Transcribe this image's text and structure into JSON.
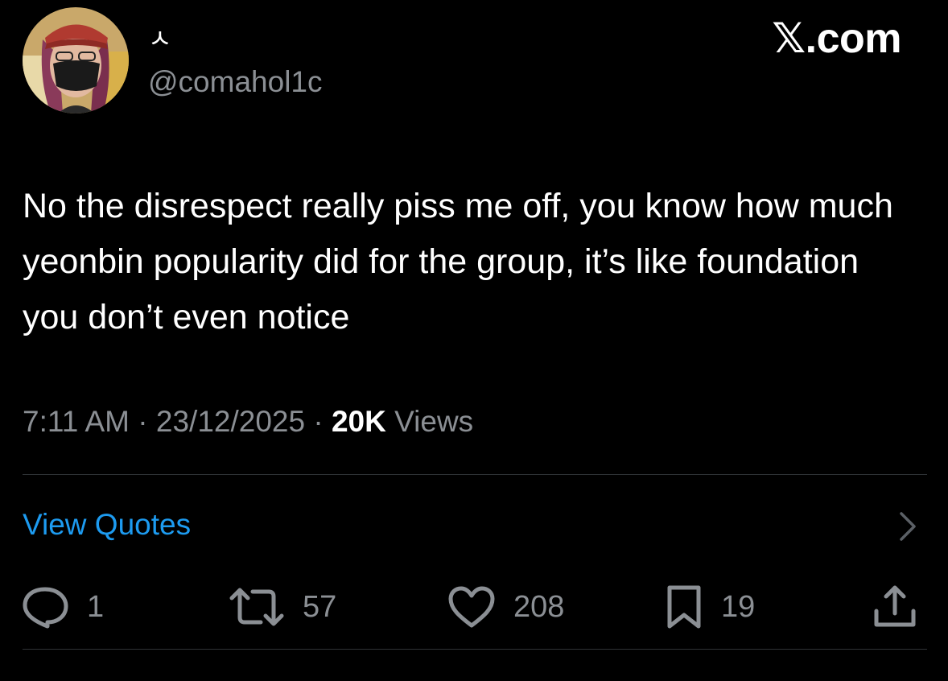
{
  "author": {
    "display_name": "ㅅ",
    "handle": "@comahol1c",
    "avatar_icon": "avatar-image"
  },
  "brand": {
    "logo_glyph": "𝕏",
    "logo_suffix": ".com"
  },
  "tweet": {
    "text": "No the disrespect really piss me off, you know how much yeonbin popularity did for the group, it’s like foundation you don’t even notice",
    "time": "7:11 AM",
    "separator": "·",
    "date": "23/12/2025",
    "views_count": "20K",
    "views_label": "Views"
  },
  "quotes": {
    "label": "View Quotes",
    "chevron_icon": "chevron-right-icon"
  },
  "actions": {
    "reply": {
      "icon": "reply-icon",
      "count": "1"
    },
    "retweet": {
      "icon": "retweet-icon",
      "count": "57"
    },
    "like": {
      "icon": "heart-icon",
      "count": "208"
    },
    "bookmark": {
      "icon": "bookmark-icon",
      "count": "19"
    },
    "share": {
      "icon": "share-icon"
    }
  },
  "colors": {
    "background": "#000000",
    "text_primary": "#ffffff",
    "text_secondary": "#8b8f94",
    "link": "#1d9bf0",
    "divider": "#2f3336"
  }
}
